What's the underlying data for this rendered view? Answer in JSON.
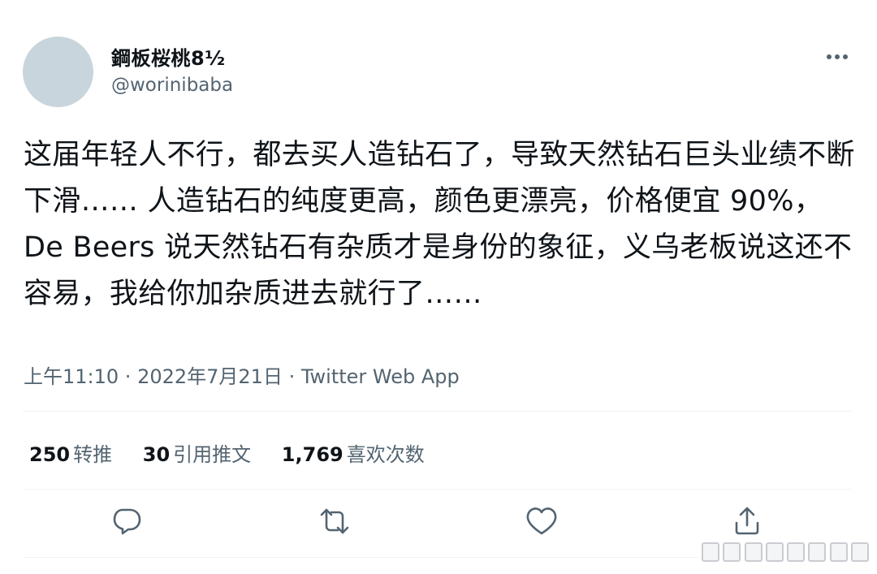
{
  "user": {
    "display_name": "鋼板桜桃8½",
    "handle": "@worinibaba"
  },
  "tweet": {
    "text": "这届年轻人不行，都去买人造钻石了，导致天然钻石巨头业绩不断下滑…… 人造钻石的纯度更高，颜色更漂亮，价格便宜 90%，De Beers 说天然钻石有杂质才是身份的象征，义乌老板说这还不容易，我给你加杂质进去就行了……"
  },
  "meta": {
    "time": "上午11:10",
    "separator1": " · ",
    "date": "2022年7月21日",
    "separator2": " · ",
    "source": "Twitter Web App"
  },
  "stats": {
    "retweets_count": "250",
    "retweets_label": "转推",
    "quotes_count": "30",
    "quotes_label": "引用推文",
    "likes_count": "1,769",
    "likes_label": "喜欢次数"
  },
  "icons": {
    "more": "more-dots-icon",
    "reply": "reply-icon",
    "retweet": "retweet-icon",
    "like": "heart-icon",
    "share": "share-icon"
  },
  "colors": {
    "text_primary": "#0f1419",
    "text_secondary": "#536471",
    "avatar": "#c8d5dc",
    "divider": "#eff3f4"
  }
}
